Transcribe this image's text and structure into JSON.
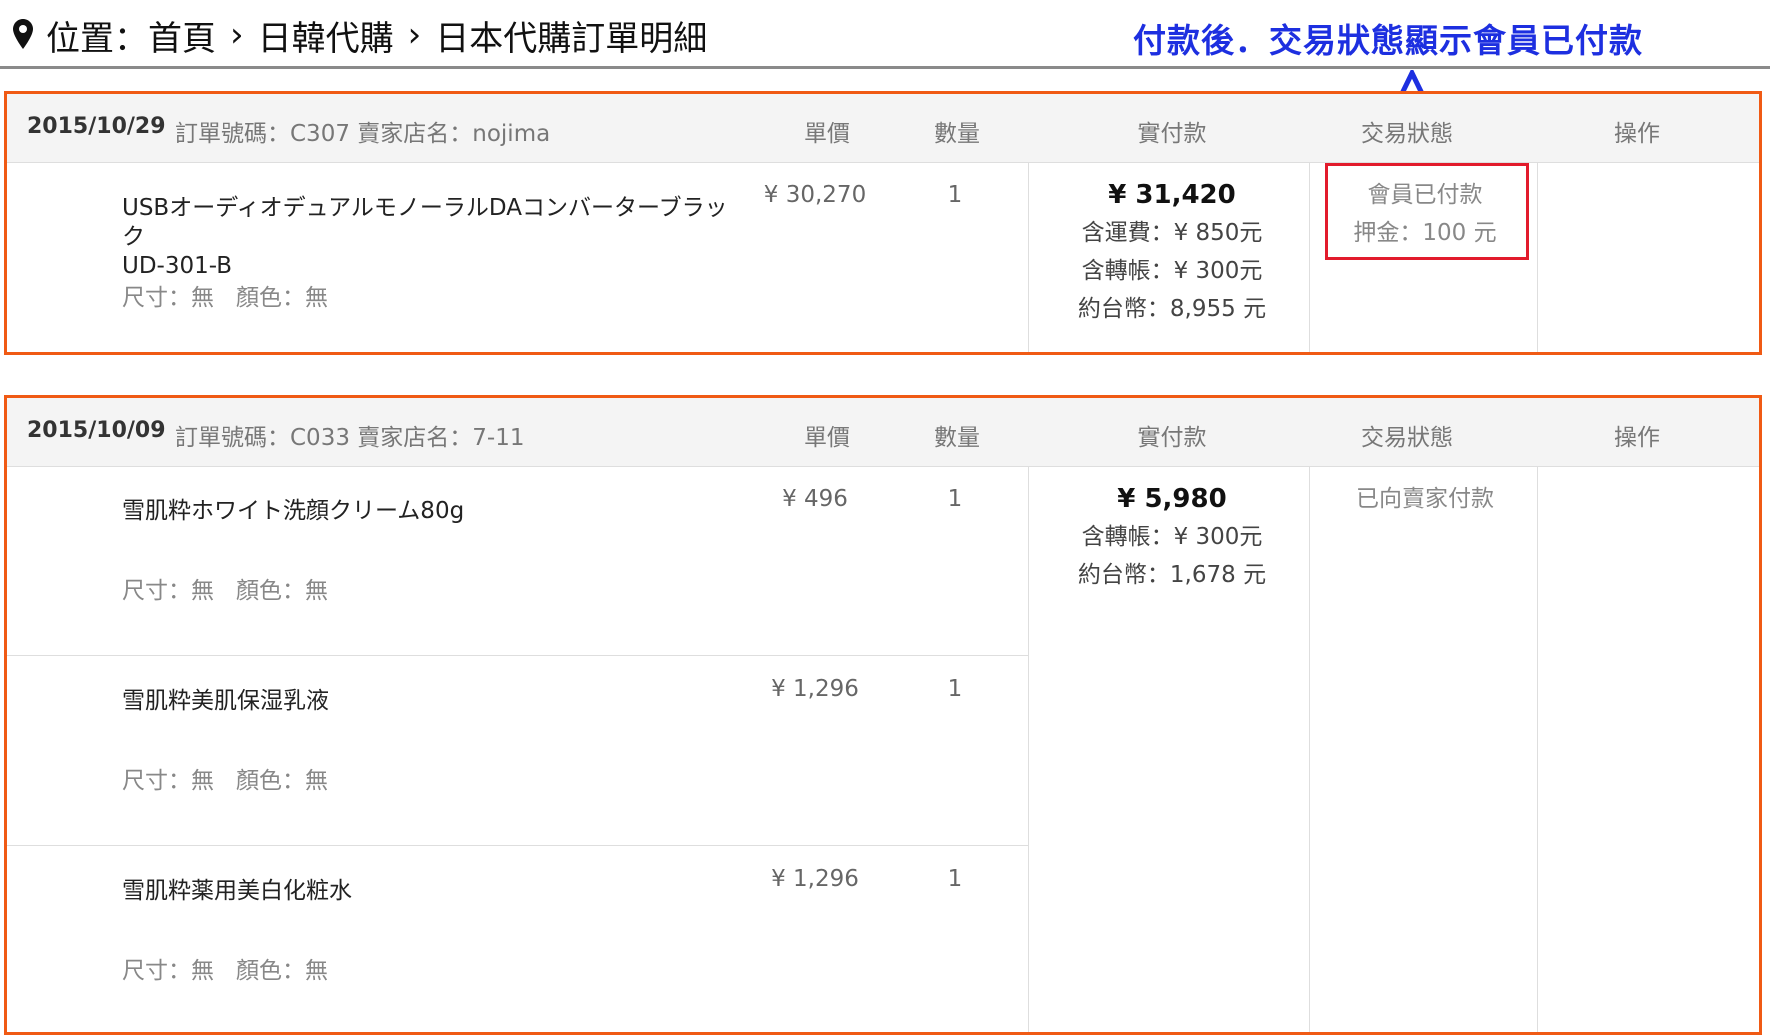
{
  "breadcrumb": {
    "prefix": "位置：",
    "items": [
      "首頁",
      "日韓代購",
      "日本代購訂單明細"
    ],
    "separator": "›"
  },
  "annotation": {
    "text": "付款後．交易狀態顯示會員已付款",
    "color": "#1d2fe0"
  },
  "headers": {
    "price": "單價",
    "qty": "數量",
    "paid": "實付款",
    "status": "交易狀態",
    "op": "操作"
  },
  "colors": {
    "order_border": "#f05a14",
    "highlight_border": "#e21b2c"
  },
  "orders": [
    {
      "date": "2015/10/29",
      "info": "訂單號碼：C307 賣家店名：nojima",
      "items": [
        {
          "name_line1": "USBオーディオデュアルモノーラルDAコンバーターブラック",
          "name_line2": "UD-301-B",
          "size": "尺寸：無",
          "color": "顏色：無",
          "price": "¥ 30,270",
          "qty": "1"
        }
      ],
      "paid": {
        "total": "¥ 31,420",
        "lines": [
          "含運費：¥ 850元",
          "含轉帳：¥ 300元",
          "約台幣：8,955 元"
        ]
      },
      "status": {
        "lines": [
          "會員已付款",
          "押金：100 元"
        ]
      }
    },
    {
      "date": "2015/10/09",
      "info": "訂單號碼：C033 賣家店名：7-11",
      "items": [
        {
          "name": "雪肌粋ホワイト洗顔クリーム80g",
          "size": "尺寸：無",
          "color": "顏色：無",
          "price": "¥ 496",
          "qty": "1"
        },
        {
          "name": "雪肌粋美肌保湿乳液",
          "size": "尺寸：無",
          "color": "顏色：無",
          "price": "¥ 1,296",
          "qty": "1"
        },
        {
          "name": "雪肌粋薬用美白化粧水",
          "size": "尺寸：無",
          "color": "顏色：無",
          "price": "¥ 1,296",
          "qty": "1"
        }
      ],
      "paid": {
        "total": "¥ 5,980",
        "lines": [
          "含轉帳：¥ 300元",
          "約台幣：1,678 元"
        ]
      },
      "status": {
        "lines": [
          "已向賣家付款"
        ]
      }
    }
  ]
}
